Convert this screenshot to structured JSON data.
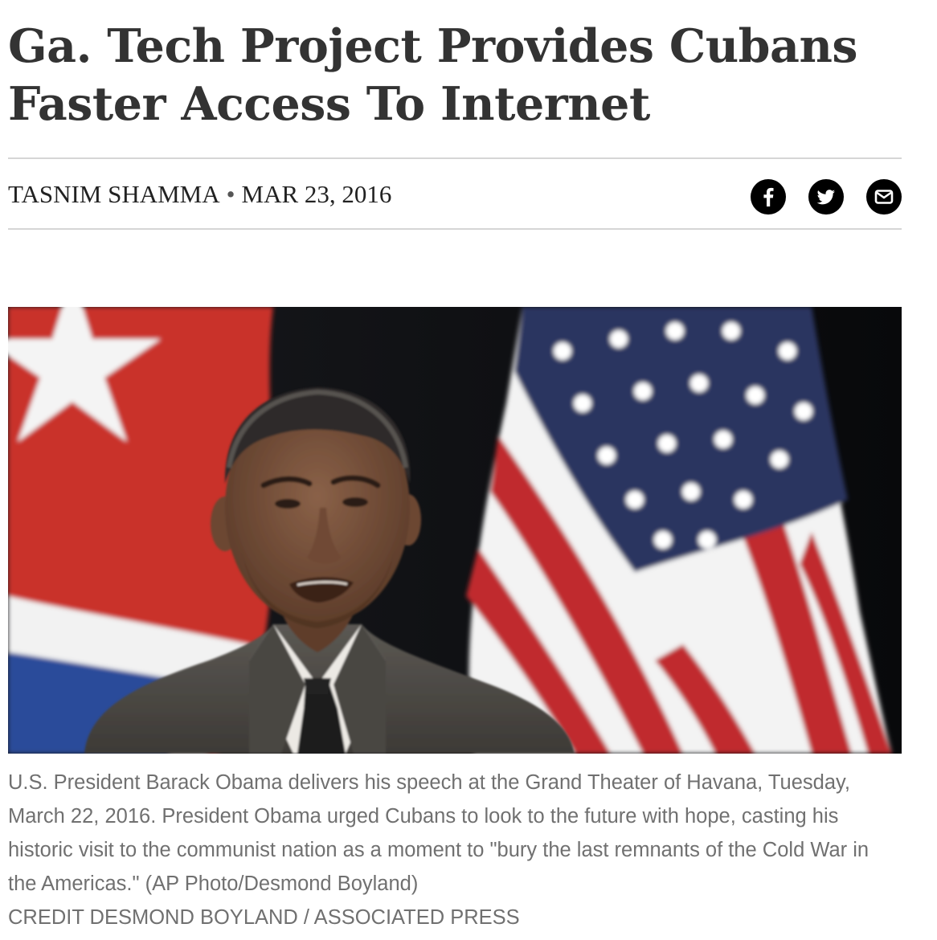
{
  "article": {
    "headline": "Ga. Tech Project Provides Cubans Faster Access To Internet",
    "author": "TASNIM SHAMMA",
    "separator": "•",
    "date": "MAR 23, 2016",
    "share": [
      {
        "icon": "facebook-icon",
        "label": "Facebook"
      },
      {
        "icon": "twitter-icon",
        "label": "Twitter"
      },
      {
        "icon": "email-icon",
        "label": "Email"
      }
    ],
    "photo": {
      "caption": "U.S. President Barack Obama delivers his speech at the Grand Theater of Havana, Tuesday, March 22, 2016. President Obama urged Cubans to look to the future with hope, casting his historic visit to the communist nation as a moment to \"bury the last remnants of the Cold War in the Americas.\" (AP Photo/Desmond Boyland)",
      "credit": "CREDIT DESMOND BOYLAND / ASSOCIATED PRESS"
    }
  },
  "colors": {
    "headline": "#333333",
    "rule": "#d6d6d6",
    "caption": "#707070",
    "share_bg": "#000000"
  }
}
